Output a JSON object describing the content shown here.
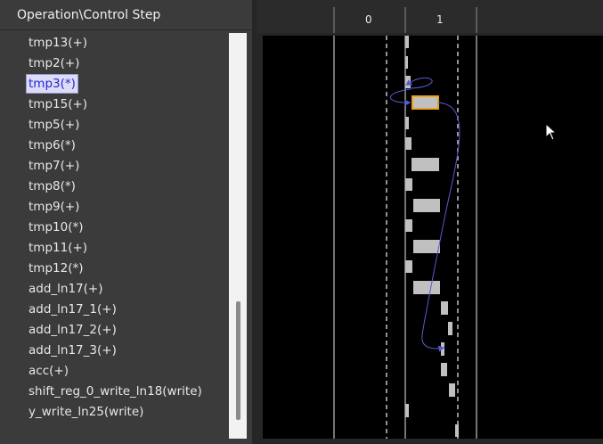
{
  "left_panel": {
    "header": "Operation\\Control Step",
    "operations": [
      "tmp13(+)",
      "tmp2(+)",
      "tmp3(*)",
      "tmp15(+)",
      "tmp5(+)",
      "tmp6(*)",
      "tmp7(+)",
      "tmp8(*)",
      "tmp9(+)",
      "tmp10(*)",
      "tmp11(+)",
      "tmp12(*)",
      "add_ln17(+)",
      "add_ln17_1(+)",
      "add_ln17_2(+)",
      "add_ln17_3(+)",
      "acc(+)",
      "shift_reg_0_write_ln18(write)",
      "y_write_ln25(write)"
    ],
    "selected_index": 2
  },
  "timeline": {
    "control_steps": [
      "0",
      "1"
    ]
  },
  "colors": {
    "background": "#000000",
    "op_bar": "#c0c0c0",
    "highlight": "#e8a21c",
    "dependency_line": "#5a5ad0",
    "selected_text": "#2525d8"
  }
}
